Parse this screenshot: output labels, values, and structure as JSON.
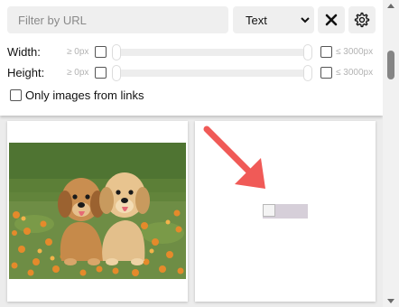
{
  "filter": {
    "placeholder": "Filter by URL",
    "value": ""
  },
  "mode_select": {
    "selected": "Text",
    "icon": "chevron-down-icon"
  },
  "buttons": {
    "close_icon": "close-icon",
    "settings_icon": "gear-icon"
  },
  "width_row": {
    "label": "Width:",
    "min_label": "≥ 0px",
    "max_label": "≤ 3000px",
    "min_checked": false,
    "max_checked": false
  },
  "height_row": {
    "label": "Height:",
    "min_label": "≥ 0px",
    "max_label": "≤ 3000px",
    "min_checked": false,
    "max_checked": false
  },
  "only_links": {
    "label": "Only images from links",
    "checked": false
  },
  "cards": [
    {
      "image": "puppies-photo"
    },
    {
      "image": "broken-image-icon"
    }
  ],
  "colors": {
    "accent_arrow": "#f05a57",
    "panel_bg": "#ffffff",
    "control_bg": "#efefef"
  }
}
